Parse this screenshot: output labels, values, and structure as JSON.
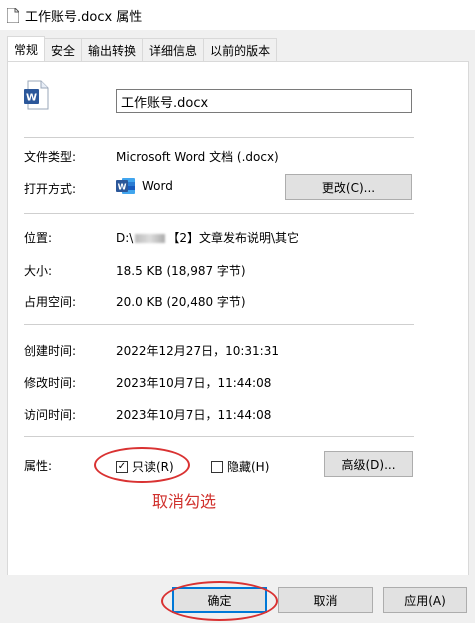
{
  "window": {
    "title": "工作账号.docx 属性"
  },
  "tabs": [
    {
      "label": "常规"
    },
    {
      "label": "安全"
    },
    {
      "label": "输出转换"
    },
    {
      "label": "详细信息"
    },
    {
      "label": "以前的版本"
    }
  ],
  "file": {
    "name": "工作账号.docx"
  },
  "fields": {
    "type_label": "文件类型:",
    "type_value": "Microsoft Word 文档 (.docx)",
    "openwith_label": "打开方式:",
    "openwith_value": "Word",
    "change_button": "更改(C)...",
    "location_label": "位置:",
    "location_prefix": "D:\\",
    "location_suffix": "【2】文章发布说明\\其它",
    "size_label": "大小:",
    "size_value": "18.5 KB (18,987 字节)",
    "disk_label": "占用空间:",
    "disk_value": "20.0 KB (20,480 字节)",
    "created_label": "创建时间:",
    "created_value": "2022年12月27日，10:31:31",
    "modified_label": "修改时间:",
    "modified_value": "2023年10月7日，11:44:08",
    "accessed_label": "访问时间:",
    "accessed_value": "2023年10月7日，11:44:08",
    "attrs_label": "属性:",
    "readonly_label": "只读(R)",
    "readonly_checked": true,
    "hidden_label": "隐藏(H)",
    "hidden_checked": false,
    "advanced_button": "高级(D)..."
  },
  "annotation": {
    "text": "取消勾选",
    "color": "#d0312d"
  },
  "footer": {
    "ok": "确定",
    "cancel": "取消",
    "apply": "应用(A)"
  },
  "colors": {
    "word_blue": "#2b579a",
    "annotation_red": "#d93232"
  }
}
